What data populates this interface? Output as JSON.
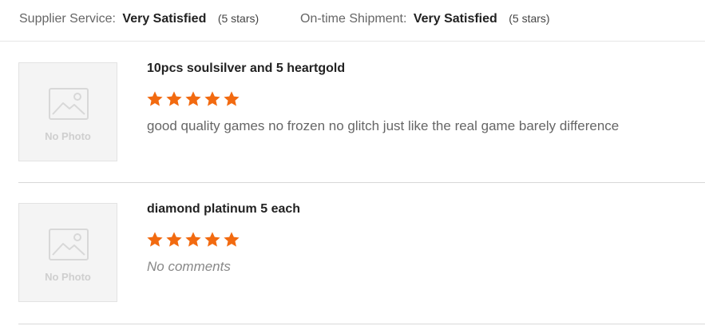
{
  "seller_ratings": [
    {
      "label": "Supplier Service:",
      "value": "Very Satisfied",
      "stars_text": "(5 stars)"
    },
    {
      "label": "On-time Shipment:",
      "value": "Very Satisfied",
      "stars_text": "(5 stars)"
    }
  ],
  "reviews": [
    {
      "thumbnail_text": "No Photo",
      "title": "10pcs soulsilver and 5 heartgold",
      "rating": 5,
      "rating_max": 5,
      "comment": "good quality games no frozen no glitch just like the real game barely difference"
    },
    {
      "thumbnail_text": "No Photo",
      "title": "diamond platinum 5 each",
      "rating": 5,
      "rating_max": 5,
      "comment": "No comments"
    }
  ],
  "colors": {
    "star": "#f26a10",
    "thumb_icon": "#d8d8d8"
  }
}
